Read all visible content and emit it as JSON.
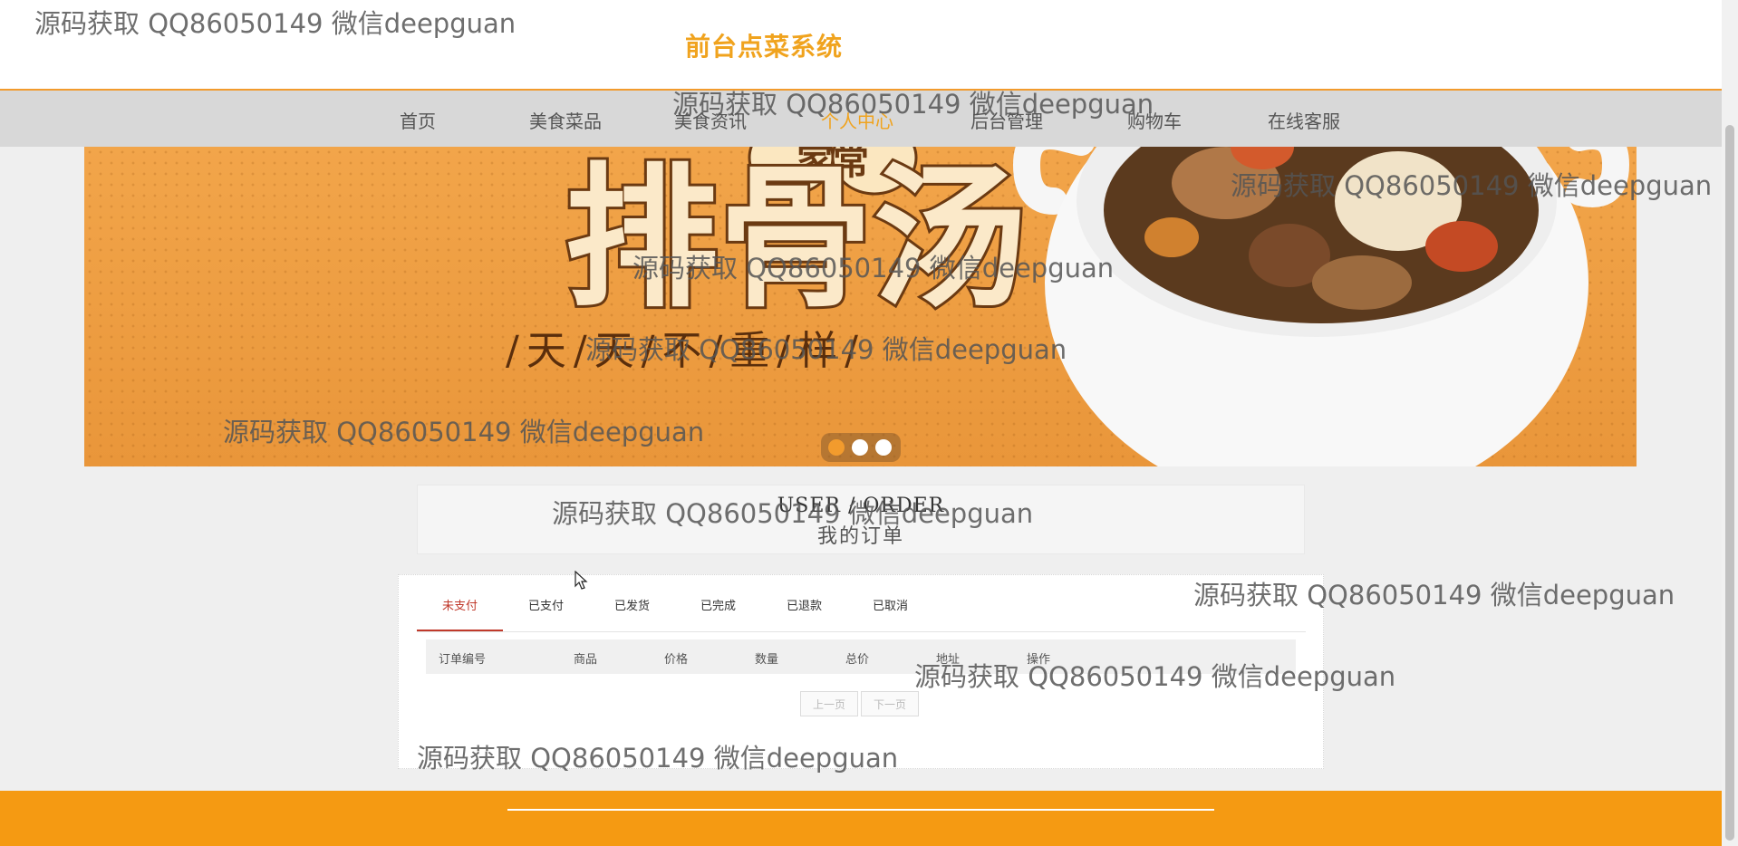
{
  "header": {
    "site_title": "前台点菜系统"
  },
  "nav": {
    "items": [
      {
        "label": "首页"
      },
      {
        "label": "美食菜品"
      },
      {
        "label": "美食资讯"
      },
      {
        "label": "个人中心",
        "active": true
      },
      {
        "label": "后台管理"
      },
      {
        "label": "购物车"
      },
      {
        "label": "在线客服"
      }
    ]
  },
  "banner": {
    "title_text": "排骨汤",
    "badge_text": "家常",
    "slogan": "/天/天/不/重/样/",
    "carousel": {
      "count": 3,
      "active_index": 0
    }
  },
  "section": {
    "title_en": "USER / ORDER",
    "title_zh": "我的订单"
  },
  "orders": {
    "tabs": [
      {
        "label": "未支付",
        "active": true
      },
      {
        "label": "已支付"
      },
      {
        "label": "已发货"
      },
      {
        "label": "已完成"
      },
      {
        "label": "已退款"
      },
      {
        "label": "已取消"
      }
    ],
    "columns": [
      "订单编号",
      "商品",
      "价格",
      "数量",
      "总价",
      "地址",
      "操作"
    ],
    "rows": [],
    "pager": {
      "prev": "上一页",
      "next": "下一页"
    }
  },
  "watermark": "源码获取 QQ86050149 微信deepguan",
  "colors": {
    "accent": "#f0a31e",
    "footer": "#f59a12",
    "active_tab": "#c0392b",
    "nav_bg": "#d8d8d8"
  }
}
